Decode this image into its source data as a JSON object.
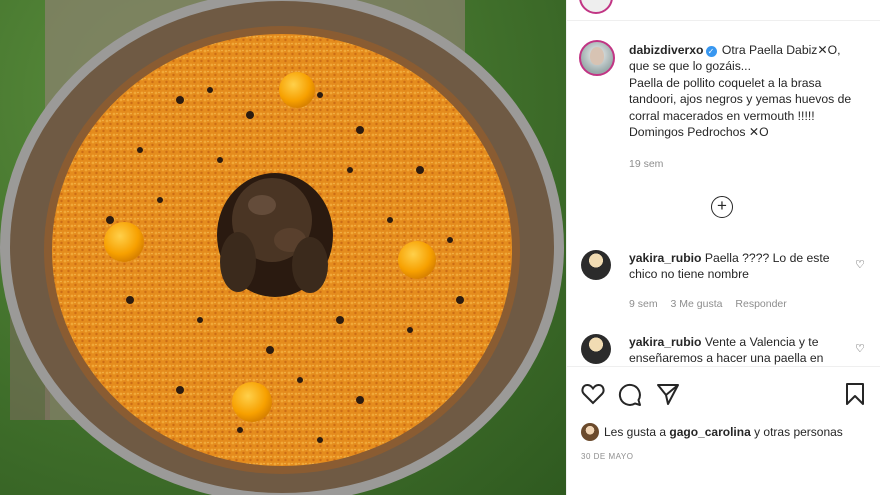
{
  "post": {
    "username": "dabizdiverxo",
    "caption_line1": "Otra Paella Dabiz✕O,",
    "caption_line2": "que se que lo gozáis...",
    "caption_line3": "Paella de pollito coquelet a la brasa",
    "caption_line4": "tandoori, ajos negros y yemas huevos de",
    "caption_line5": "corral macerados en vermouth !!!!!",
    "caption_line6": "Domingos Pedrochos ✕O",
    "time": "19 sem",
    "load_more_symbol": "+"
  },
  "comments": [
    {
      "username": "yakira_rubio",
      "text_line1": "Paella ???? Lo de este",
      "text_line2": "chico no tiene nombre",
      "time": "9 sem",
      "likes": "3 Me gusta",
      "reply": "Responder"
    },
    {
      "username": "yakira_rubio",
      "text_line1": "Vente a Valencia y te",
      "text_line2": "enseñaremos a hacer una paella en"
    }
  ],
  "actions": {
    "like_icon": "heart-icon",
    "comment_icon": "comment-icon",
    "share_icon": "send-icon",
    "save_icon": "bookmark-icon"
  },
  "likes": {
    "prefix": "Les gusta a",
    "user": "gago_carolina",
    "suffix": "y otras personas"
  },
  "date": "30 DE MAYO",
  "colors": {
    "verified": "#3897f0",
    "rice": "#e7901f",
    "yolk": "#f7a000"
  }
}
